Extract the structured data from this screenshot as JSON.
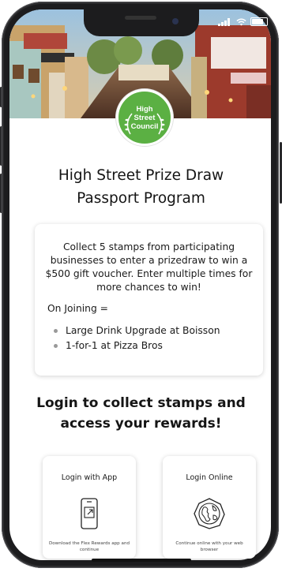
{
  "status_bar": {
    "icons": [
      "signal-icon",
      "wifi-icon",
      "battery-icon"
    ]
  },
  "hero": {
    "image": "street-photo",
    "badge": {
      "line1": "High",
      "line2": "Street",
      "line3": "Council"
    }
  },
  "title": {
    "line1": "High Street Prize Draw",
    "line2": "Passport Program"
  },
  "info": {
    "description": "Collect 5 stamps from participating businesses to enter a prizedraw to win a $500 gift voucher. Enter multiple times for more chances to win!",
    "joining_label": "On Joining =",
    "perks": [
      "Large Drink Upgrade at Boisson",
      "1-for-1 at Pizza Bros"
    ]
  },
  "login": {
    "heading_line1": "Login to collect stamps and",
    "heading_line2": "access your rewards!",
    "options": [
      {
        "title": "Login with App",
        "icon": "phone-icon",
        "subtitle": "Download the Flex Rewards app and continue"
      },
      {
        "title": "Login Online",
        "icon": "globe-icon",
        "subtitle": "Continue online with your web browser"
      }
    ]
  },
  "colors": {
    "accent_green": "#5bb043",
    "text": "#151515"
  }
}
